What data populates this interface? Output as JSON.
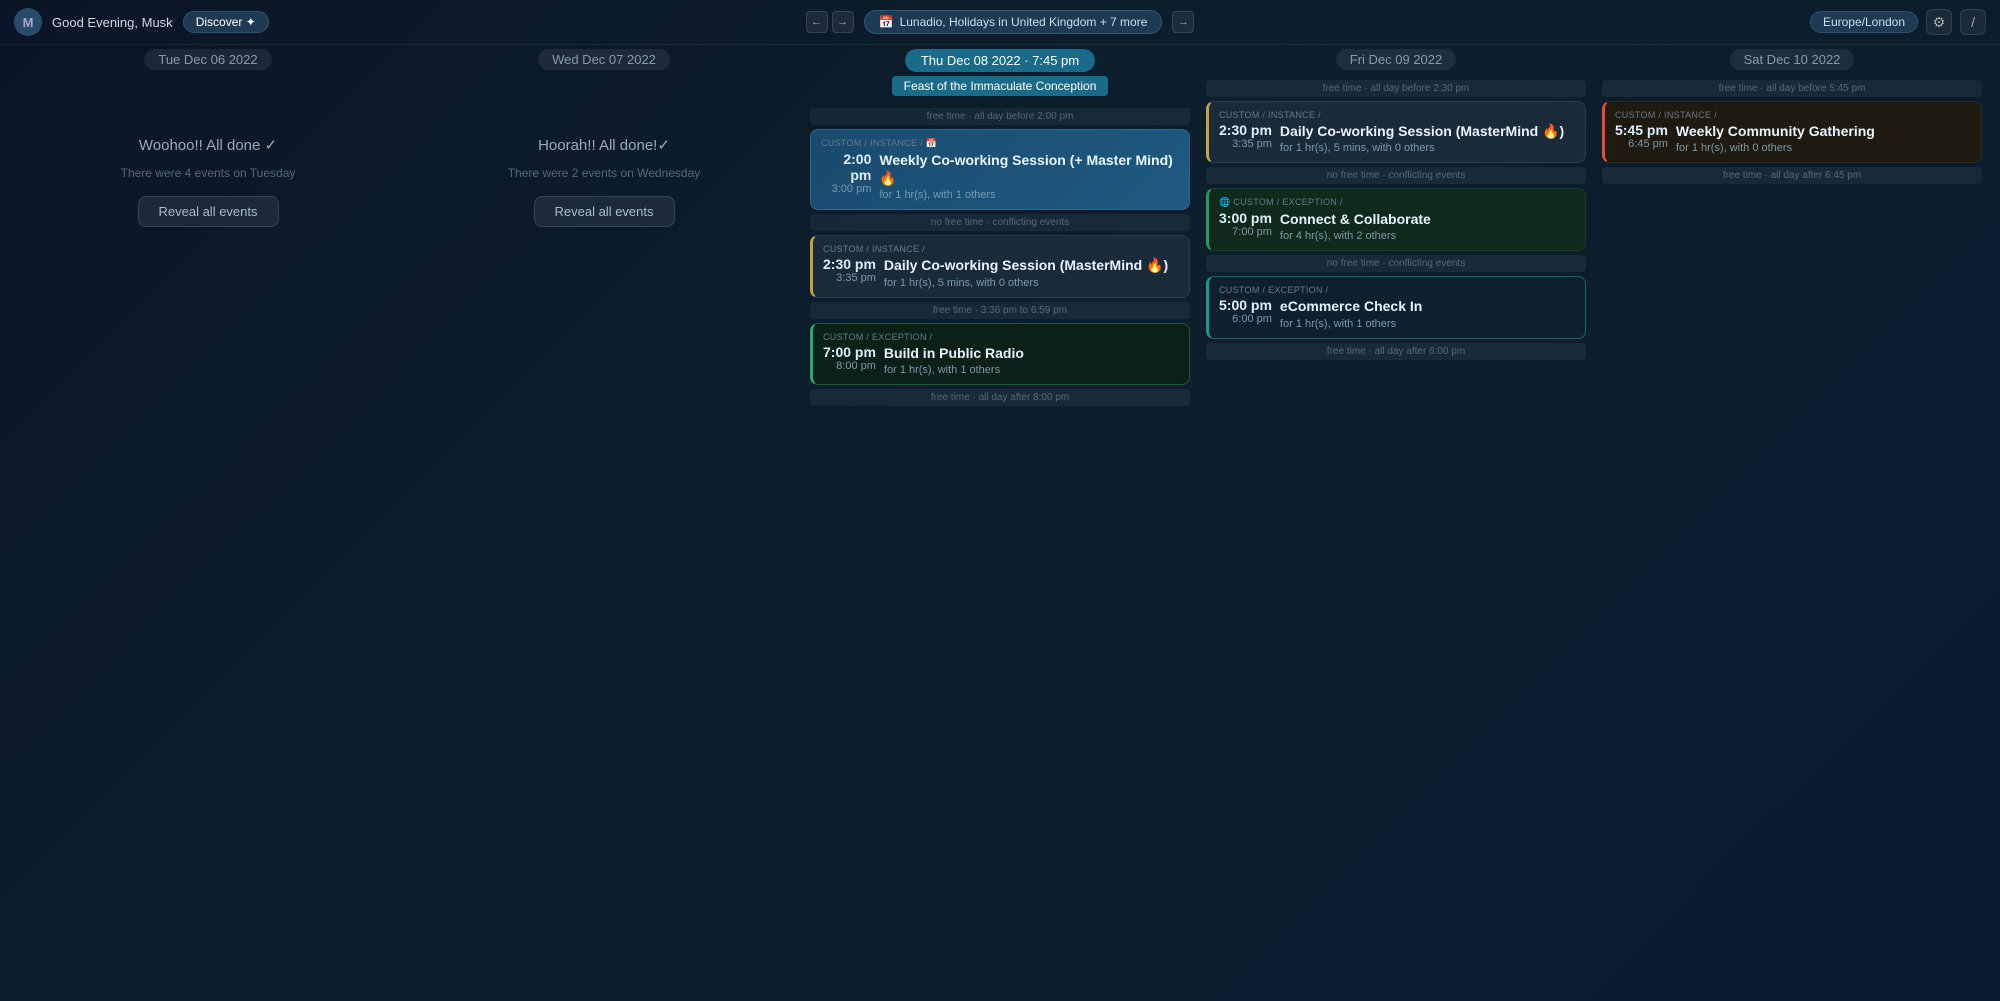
{
  "topbar": {
    "avatar_letter": "M",
    "greeting": "Good Evening, Musk",
    "discover_label": "Discover ✦",
    "nav_prev": "←",
    "nav_next": "→",
    "calendar_icon": "📅",
    "calendar_label": "Lunadio, Holidays in United Kingdom + 7 more",
    "forward_arrow": "→",
    "timezone_label": "Europe/London",
    "settings_icon": "⚙",
    "user_icon": "/"
  },
  "days": [
    {
      "id": "tue",
      "label": "Tue Dec 06 2022",
      "today": false,
      "done": true,
      "done_text": "Woohoo!! All done ✓",
      "events_count_text": "There were 4 events on Tuesday",
      "reveal_label": "Reveal all events",
      "events": []
    },
    {
      "id": "wed",
      "label": "Wed Dec 07 2022",
      "today": false,
      "done": true,
      "done_text": "Hoorah!! All done!✓",
      "events_count_text": "There were 2 events on Wednesday",
      "reveal_label": "Reveal all events",
      "events": []
    },
    {
      "id": "thu",
      "label": "Thu Dec 08 2022 · 7:45 pm",
      "today": true,
      "holiday": "Feast of the Immaculate Conception",
      "done": false,
      "events": [
        {
          "id": "thu-e1",
          "meta": "CUSTOM / instance / 📅",
          "start": "2:00 pm",
          "end": "3:00 pm",
          "title": "Weekly Co-working Session (+ Master Mind) 🔥",
          "sub": "for 1 hr(s), with 1 others",
          "style": "blue",
          "free_before": "free time · all day before 2:00 pm",
          "free_after": null
        },
        {
          "id": "thu-e2",
          "meta": "CUSTOM / instance /",
          "start": "2:30 pm",
          "end": "3:35 pm",
          "title": "Daily Co-working Session (MasterMind 🔥)",
          "sub": "for 1 hr(s), 5 mins, with 0 others",
          "style": "yellow-left",
          "free_before": "no free time · conflicting events",
          "free_after": "free time · 3:36 pm to 6:59 pm"
        },
        {
          "id": "thu-e3",
          "meta": "CUSTOM / exception /",
          "start": "7:00 pm",
          "end": "8:00 pm",
          "title": "Build in Public Radio",
          "sub": "for 1 hr(s), with 1 others",
          "style": "green-border",
          "free_before": null,
          "free_after": "free time · all day after 8:00 pm"
        }
      ]
    },
    {
      "id": "fri",
      "label": "Fri Dec 09 2022",
      "today": false,
      "done": false,
      "events": [
        {
          "id": "fri-e1",
          "meta": "CUSTOM / instance /",
          "start": "2:30 pm",
          "end": "3:35 pm",
          "title": "Daily Co-working Session (MasterMind 🔥)",
          "sub": "for 1 hr(s), 5 mins, with 0 others",
          "style": "yellow-left",
          "free_before": "free time · all day before 2:30 pm",
          "free_after": null
        },
        {
          "id": "fri-e2",
          "meta": "🌐 CUSTOM / exception /",
          "start": "3:00 pm",
          "end": "7:00 pm",
          "title": "Connect & Collaborate",
          "sub": "for 4 hr(s), with 2 others",
          "style": "green-left",
          "free_before": "no free time · conflicting events",
          "free_after": null
        },
        {
          "id": "fri-e3",
          "meta": "CUSTOM / exception /",
          "start": "5:00 pm",
          "end": "6:00 pm",
          "title": "eCommerce Check In",
          "sub": "for 1 hr(s), with 1 others",
          "style": "teal-border",
          "free_before": "no free time · conflicting events",
          "free_after": "free time · all day after 6:00 pm"
        }
      ]
    },
    {
      "id": "sat",
      "label": "Sat Dec 10 2022",
      "today": false,
      "done": false,
      "events": [
        {
          "id": "sat-e1",
          "meta": "CUSTOM / instance /",
          "start": "5:45 pm",
          "end": "6:45 pm",
          "title": "Weekly Community Gathering",
          "sub": "for 1 hr(s), with 0 others",
          "style": "orange-left",
          "free_before": "free time · all day before 5:45 pm",
          "free_after": "free time · all day after 6:45 pm"
        }
      ]
    }
  ]
}
